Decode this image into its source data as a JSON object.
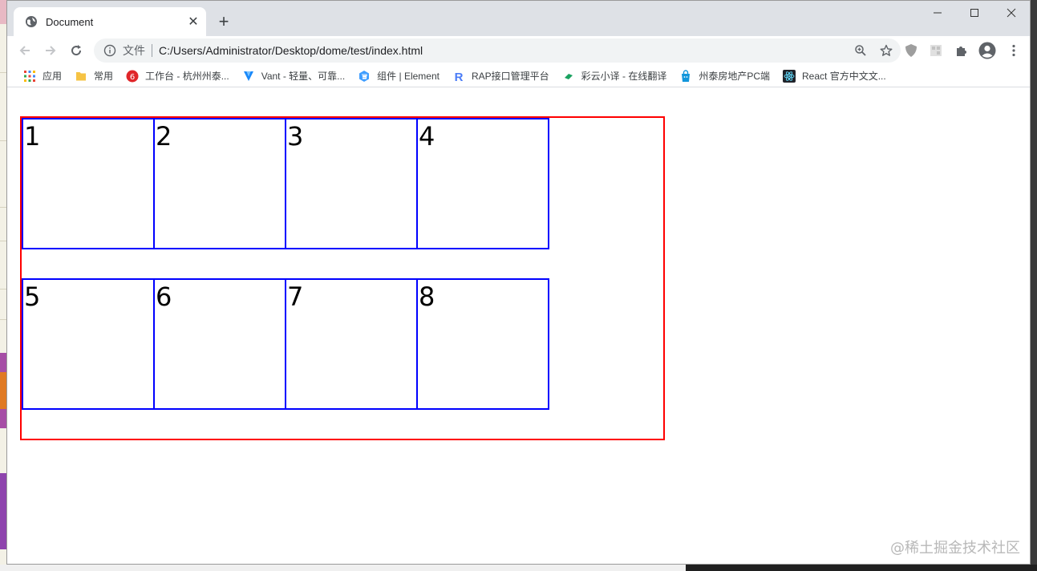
{
  "tab": {
    "title": "Document"
  },
  "address_bar": {
    "scheme_label": "文件",
    "url": "C:/Users/Administrator/Desktop/dome/test/index.html"
  },
  "bookmarks": [
    {
      "label": "应用",
      "icon": "apps-grid-icon"
    },
    {
      "label": "常用",
      "icon": "folder-icon"
    },
    {
      "label": "工作台 - 杭州州泰...",
      "icon": "workbench-icon"
    },
    {
      "label": "Vant - 轻量、可靠...",
      "icon": "vant-icon"
    },
    {
      "label": "组件 | Element",
      "icon": "element-icon"
    },
    {
      "label": "RAP接口管理平台",
      "icon": "rap-icon"
    },
    {
      "label": "彩云小译 - 在线翻译",
      "icon": "caiyun-icon"
    },
    {
      "label": "州泰房地产PC端",
      "icon": "bag-icon"
    },
    {
      "label": "React 官方中文文...",
      "icon": "react-icon"
    }
  ],
  "page": {
    "cells": [
      "1",
      "2",
      "3",
      "4",
      "5",
      "6",
      "7",
      "8"
    ],
    "container_border_color": "#ff0000",
    "cell_border_color": "#0000ff"
  },
  "watermark": "@稀土掘金技术社区"
}
